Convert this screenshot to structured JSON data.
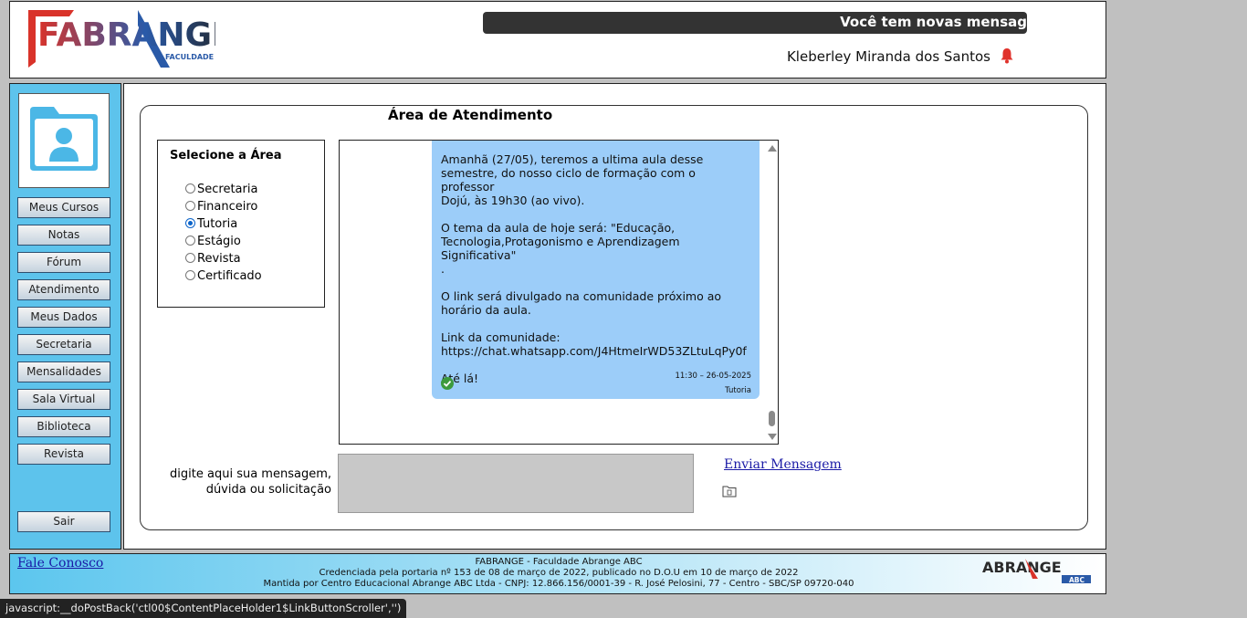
{
  "header": {
    "logo_text": "FABRANGE",
    "logo_sub": "FACULDADE",
    "ticker": "Você tem novas mensag",
    "user_name": "Kleberley Miranda dos Santos"
  },
  "sidebar": {
    "items": [
      {
        "label": "Meus Cursos"
      },
      {
        "label": "Notas"
      },
      {
        "label": "Fórum"
      },
      {
        "label": "Atendimento"
      },
      {
        "label": "Meus Dados"
      },
      {
        "label": "Secretaria"
      },
      {
        "label": "Mensalidades"
      },
      {
        "label": "Sala Virtual"
      },
      {
        "label": "Biblioteca"
      },
      {
        "label": "Revista"
      }
    ],
    "logout": "Sair"
  },
  "main": {
    "title": "Área de Atendimento",
    "area_select": {
      "title": "Selecione a Área",
      "options": [
        {
          "label": "Secretaria",
          "checked": false
        },
        {
          "label": "Financeiro",
          "checked": false
        },
        {
          "label": "Tutoria",
          "checked": true
        },
        {
          "label": "Estágio",
          "checked": false
        },
        {
          "label": "Revista",
          "checked": false
        },
        {
          "label": "Certificado",
          "checked": false
        }
      ]
    },
    "message": {
      "paragraphs": [
        "Amanhã (27/05), teremos a ultima aula desse\nsemestre, do nosso ciclo de formação com o professor\nDojú, às 19h30 (ao vivo).",
        "O tema da aula de hoje será: \"Educação,\nTecnologia,Protagonismo e Aprendizagem Significativa\"\n.",
        "O link será divulgado na comunidade próximo ao\nhorário da aula.",
        "Link da comunidade:\nhttps://chat.whatsapp.com/J4HtmeIrWD53ZLtuLqPy0f",
        "Até lá!"
      ],
      "time": "11:30  –  26-05-2025",
      "area": "Tutoria"
    },
    "input_label": "digite aqui sua mensagem,\ndúvida ou solicitação",
    "send_label": "Enviar Mensagem"
  },
  "footer": {
    "contact": "Fale Conosco",
    "line1": "FABRANGE - Faculdade Abrange ABC",
    "line2": "Credenciada pela portaria nº 153 de 08 de março de 2022, publicado no D.O.U em 10 de março de 2022",
    "line3": "Mantida por Centro Educacional Abrange ABC Ltda - CNPJ: 12.866.156/0001-39 - R. José Pelosini, 77 - Centro - SBC/SP 09720-040",
    "logo_text": "ABRANGE",
    "logo_sub": "ABC"
  },
  "status_bar": "javascript:__doPostBack('ctl00$ContentPlaceHolder1$LinkButtonScroller','')",
  "colors": {
    "sidebar_bg": "#5dc3ec",
    "bubble_bg": "#9ccdf9",
    "logo_red": "#d9332a",
    "logo_blue": "#2a5aa8"
  }
}
